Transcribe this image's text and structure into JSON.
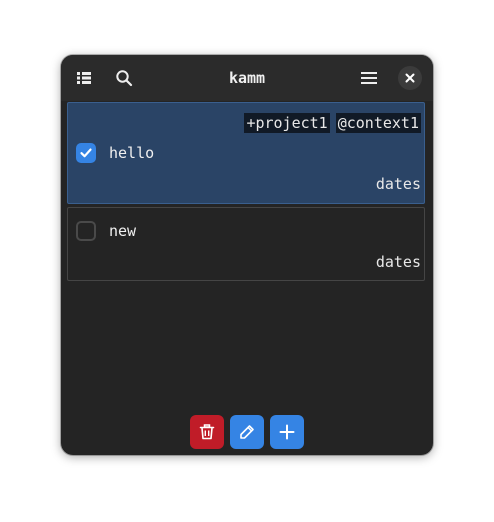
{
  "window": {
    "title": "kamm"
  },
  "header": {
    "left_icons": [
      "sidebar-list-icon",
      "search-icon"
    ],
    "right_icons": [
      "hamburger-menu-icon",
      "close-icon"
    ]
  },
  "tasks": [
    {
      "text": "hello",
      "checked": true,
      "selected": true,
      "tags": [
        "+project1",
        "@context1"
      ],
      "dates_label": "dates"
    },
    {
      "text": "new",
      "checked": false,
      "selected": false,
      "tags": [],
      "dates_label": "dates"
    }
  ],
  "actions": {
    "icons": [
      "trash-icon",
      "pencil-icon",
      "plus-icon"
    ]
  },
  "colors": {
    "accent": "#3584e4",
    "destructive": "#c01c28",
    "selected_row": "#2a4466",
    "window_bg": "#242424",
    "header_bg": "#2b2b2b"
  }
}
